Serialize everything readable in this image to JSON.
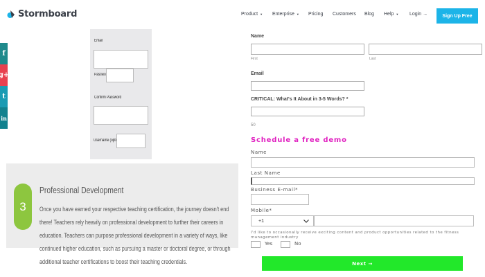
{
  "header": {
    "logo_text": "Stormboard",
    "nav": [
      {
        "label": "Product",
        "has_caret": true
      },
      {
        "label": "Enterprise",
        "has_caret": true
      },
      {
        "label": "Pricing",
        "has_caret": false
      },
      {
        "label": "Customers",
        "has_caret": false
      },
      {
        "label": "Blog",
        "has_caret": false
      },
      {
        "label": "Help",
        "has_caret": true
      }
    ],
    "login": "Login →",
    "signup": "Sign Up Free",
    "accent": "#1cb4e8"
  },
  "social": [
    {
      "icon": "facebook-icon",
      "glyph": "f"
    },
    {
      "icon": "google-plus-icon",
      "glyph": "g+"
    },
    {
      "icon": "twitter-icon",
      "glyph": "t"
    },
    {
      "icon": "linkedin-icon",
      "glyph": "in"
    }
  ],
  "mini_form": {
    "email": "Email",
    "password": "Password",
    "confirm_password": "Confirm Password",
    "username": "Username (optional)"
  },
  "step": {
    "number": "3",
    "title": "Professional Development",
    "body": "Once you have earned your respective teaching certification, the journey doesn't end there! Teachers rely heavily on professional development to further their careers in education. Teachers can purpose professional development in a variety of ways, like continued higher education, such as pursuing a master or doctoral degree, or through additional teacher certifications to boost their teaching credentials.",
    "accent": "#8dc63f"
  },
  "form1": {
    "name_label": "Name",
    "first_label": "First",
    "last_label": "Last",
    "email_label": "Email",
    "critical_label": "CRITICAL: What's It About in 3-5 Words? *",
    "char_count": "50"
  },
  "demo_form": {
    "title": "Schedule a free demo",
    "name_label": "Name",
    "last_name_label": "Last Name",
    "business_email_label": "Business E-mail*",
    "mobile_label": "Mobile*",
    "country_code": "+1",
    "consent": "I'd like to occasionally receive exciting content and product opportunities related to the fitness management industry",
    "yes_label": "Yes",
    "no_label": "No",
    "next_label": "Next →",
    "title_color": "#e020c0",
    "button_color": "#22e82a"
  }
}
